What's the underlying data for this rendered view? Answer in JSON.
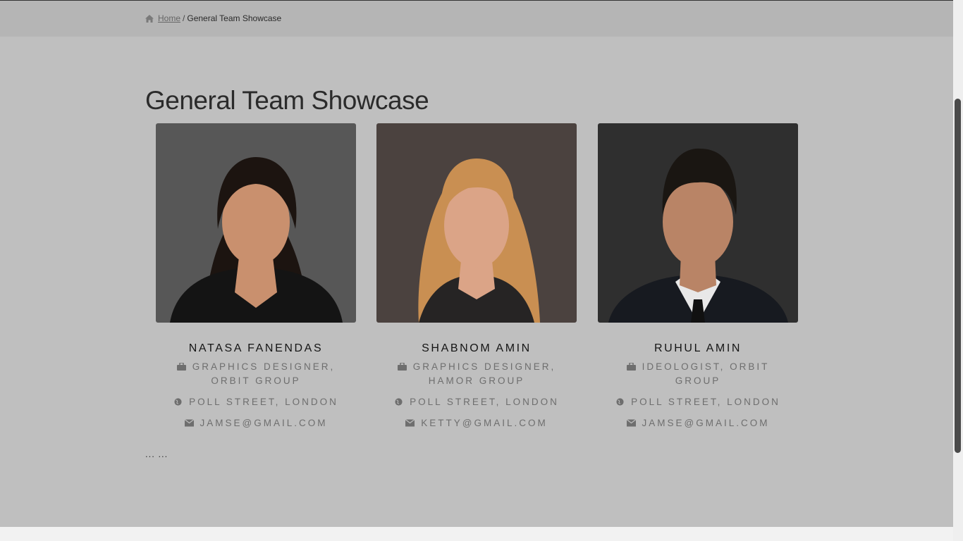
{
  "breadcrumb": {
    "home_label": "Home",
    "separator": "/",
    "current_label": "General Team Showcase"
  },
  "page": {
    "title": "General Team Showcase",
    "ellipsis": "... ..."
  },
  "team": [
    {
      "name": "NATASA FANENDAS",
      "role": "GRAPHICS DESIGNER, ORBIT GROUP",
      "location": "POLL STREET, LONDON",
      "email": "JAMSE@GMAIL.COM",
      "photo_bg": "#575757",
      "hair_color": "#1c1410",
      "skin_color": "#c9906e",
      "clothes_color": "#141414"
    },
    {
      "name": "SHABNOM AMIN",
      "role": "GRAPHICS DESIGNER, HAMOR GROUP",
      "location": "POLL STREET, LONDON",
      "email": "KETTY@GMAIL.COM",
      "photo_bg": "#4b423f",
      "hair_color": "#c98f52",
      "skin_color": "#dba487",
      "clothes_color": "#262424"
    },
    {
      "name": "RUHUL AMIN",
      "role": "IDEOLOGIST, ORBIT GROUP",
      "location": "POLL STREET, LONDON",
      "email": "JAMSE@GMAIL.COM",
      "photo_bg": "#2f2f2f",
      "hair_color": "#1a1612",
      "skin_color": "#b98466",
      "clothes_color": "#171a20"
    }
  ],
  "colors": {
    "overlay": "#bfbfbf",
    "breadcrumb_bar": "#b5b5b5",
    "text_muted": "#6e6e6e",
    "name_text": "#151515"
  },
  "icons": {
    "breadcrumb": "home-icon",
    "role": "briefcase-icon",
    "location": "globe-icon",
    "email": "envelope-icon"
  }
}
